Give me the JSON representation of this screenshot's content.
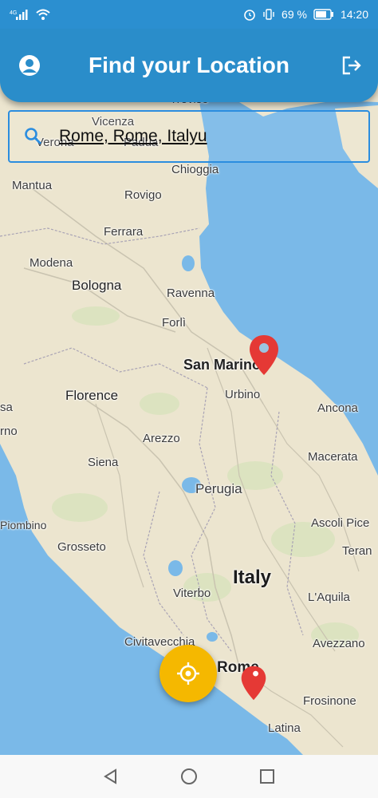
{
  "status_bar": {
    "signal_text": "4G",
    "battery_percent": "69 %",
    "time": "14:20",
    "icons": [
      "signal-icon",
      "wifi-icon",
      "alarm-icon",
      "vibrate-icon",
      "battery-icon"
    ]
  },
  "header": {
    "title": "Find your Location",
    "left_icon": "profile-icon",
    "right_icon": "logout-icon",
    "color": "#2a8dca"
  },
  "search": {
    "value": "Rome, Rome, Italyu",
    "icon": "search-icon",
    "border_color": "#2b8ddf"
  },
  "map": {
    "cities": {
      "treviso": "Treviso",
      "vicenza": "Vicenza",
      "verona": "Verona",
      "padua": "Padua",
      "chioggia": "Chioggia",
      "mantua": "Mantua",
      "rovigo": "Rovigo",
      "ferrara": "Ferrara",
      "modena": "Modena",
      "bologna": "Bologna",
      "ravenna": "Ravenna",
      "forli": "Forlì",
      "san_marino": "San Marino",
      "urbino": "Urbino",
      "ancona": "Ancona",
      "florence": "Florence",
      "pisa_partial": "sa",
      "livorno_partial": "rno",
      "arezzo": "Arezzo",
      "macerata": "Macerata",
      "siena": "Siena",
      "perugia": "Perugia",
      "piombino": "Piombino",
      "ascoli": "Ascoli Pice",
      "grosseto": "Grosseto",
      "teramo": "Teran",
      "italy": "Italy",
      "viterbo": "Viterbo",
      "laquila": "L'Aquila",
      "civitavecchia": "Civitavecchia",
      "avezzano": "Avezzano",
      "rome": "Rome",
      "frosinone": "Frosinone",
      "latina": "Latina"
    },
    "land_color": "#ece5cf",
    "sea_color": "#7ab9e8",
    "marker_color": "#e53935"
  },
  "fab": {
    "icon": "gps-crosshair-icon",
    "color": "#f5b800"
  },
  "nav": {
    "icons": [
      "back-icon",
      "home-icon",
      "recents-icon"
    ]
  }
}
